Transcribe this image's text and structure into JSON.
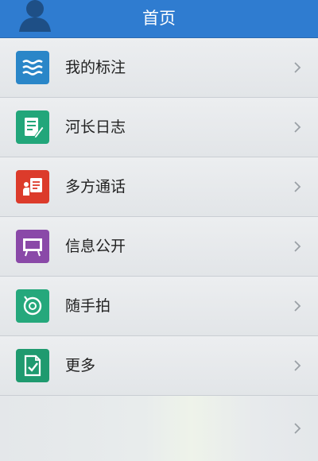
{
  "header": {
    "title": "首页",
    "avatar_icon": "user-silhouette-icon",
    "bg_color": "#2f7cd0"
  },
  "menu": {
    "items": [
      {
        "label": "我的标注",
        "icon": "waves-icon",
        "icon_color": "#2a86c8"
      },
      {
        "label": "河长日志",
        "icon": "journal-icon",
        "icon_color": "#22a67a"
      },
      {
        "label": "多方通话",
        "icon": "conference-icon",
        "icon_color": "#dc3b2b"
      },
      {
        "label": "信息公开",
        "icon": "presentation-board-icon",
        "icon_color": "#8a49a8"
      },
      {
        "label": "随手拍",
        "icon": "camera-icon",
        "icon_color": "#25a87c"
      },
      {
        "label": "更多",
        "icon": "document-check-icon",
        "icon_color": "#1f9a6f"
      }
    ]
  }
}
